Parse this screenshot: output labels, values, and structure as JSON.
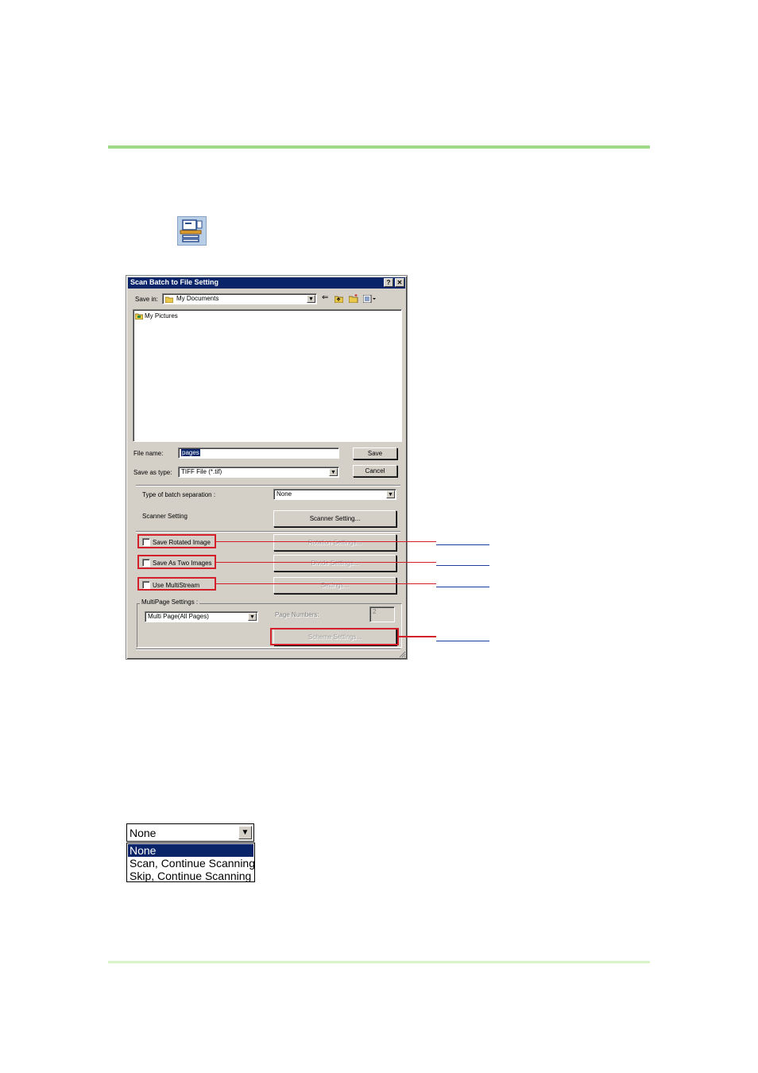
{
  "dialog": {
    "title": "Scan Batch to File Setting",
    "help_label": "?",
    "close_label": "✕",
    "save_in_label": "Save in:",
    "save_in_value": "My Documents",
    "file_list": [
      "My Pictures"
    ],
    "file_name_label": "File name:",
    "file_name_value": "pages",
    "save_as_type_label": "Save as type:",
    "save_as_type_value": "TIFF File (*.tif)",
    "save_button": "Save",
    "cancel_button": "Cancel",
    "batch_separation_label": "Type of batch separation :",
    "batch_separation_value": "None",
    "scanner_setting_label": "Scanner Setting",
    "scanner_setting_button": "Scanner Setting...",
    "save_rotated_label": "Save Rotated Image",
    "rotation_settings_button": "Rotation Settings...",
    "save_two_images_label": "Save As Two Images",
    "divide_settings_button": "Divide Settings...",
    "use_multistream_label": "Use MultiStream",
    "settings_button": "Settings...",
    "multipage_group_label": "MultiPage Settings :",
    "multipage_value": "Multi Page(All Pages)",
    "page_numbers_label": "Page Numbers:",
    "page_numbers_value": "2",
    "scheme_settings_button": "Scheme Settings..."
  },
  "dropdown_example": {
    "value": "None",
    "options": [
      "None",
      "Scan, Continue Scanning",
      "Skip, Continue Scanning"
    ],
    "selected_index": 0
  },
  "colors": {
    "accent_rule": "#9fd98a",
    "callout_red": "#d21f2a",
    "callout_blue": "#1f3fa0",
    "titlebar": "#0a246a"
  }
}
